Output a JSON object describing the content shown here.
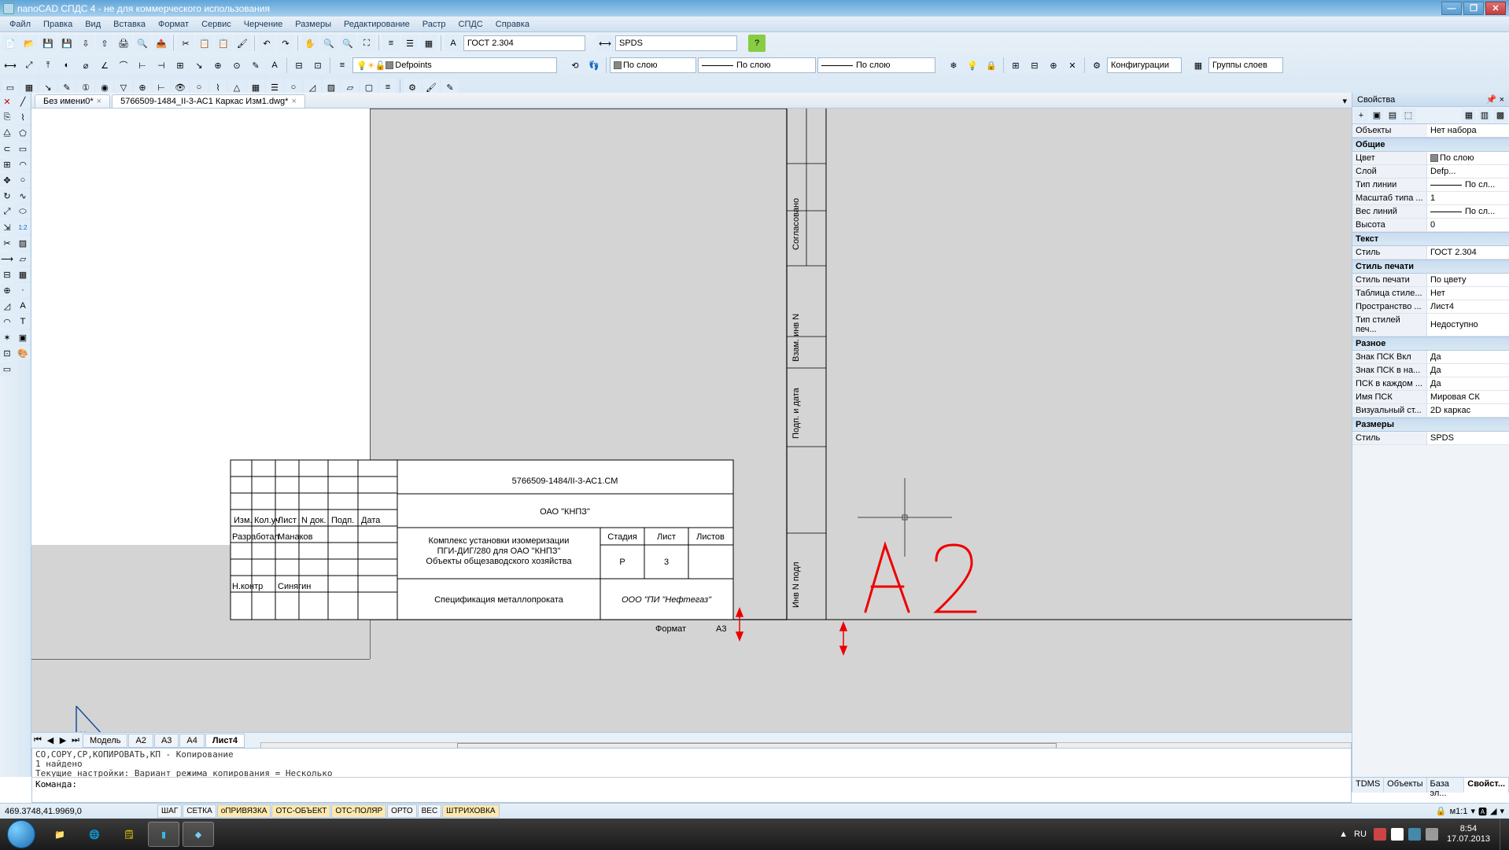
{
  "title": "nanoCAD СПДС 4 - не для коммерческого использования",
  "menubar": [
    "Файл",
    "Правка",
    "Вид",
    "Вставка",
    "Формат",
    "Сервис",
    "Черчение",
    "Размеры",
    "Редактирование",
    "Растр",
    "СПДС",
    "Справка"
  ],
  "toolbar1": {
    "textstyle": "ГОСТ 2.304",
    "dimstyle": "SPDS"
  },
  "toolbar2": {
    "layer_name": "Defpoints",
    "lineweight": "По слою",
    "linetype_label": "По слою",
    "color_label": "По слою",
    "config_btn": "Конфигурации",
    "groups_btn": "Группы слоев"
  },
  "doc_tabs": [
    {
      "label": "Без имени0*",
      "active": false
    },
    {
      "label": "5766509-1484_II-3-АС1 Каркас Изм1.dwg*",
      "active": true
    }
  ],
  "bottom_tabs": {
    "items": [
      "Модель",
      "А2",
      "А3",
      "А4",
      "Лист4"
    ],
    "active": 4
  },
  "drawing": {
    "title_block_number": "5766509-1484/II-3-АС1.СМ",
    "org": "ОАО \"КНПЗ\"",
    "desc1": "Комплекс установки изомеризации",
    "desc2": "ПГИ-ДИГ/280 для ОАО \"КНПЗ\"",
    "desc3": "Объекты общезаводского хозяйства",
    "spec": "Спецификация металлопроката",
    "contractor": "ООО \"ПИ \"Нефтегаз\"",
    "col_izm": "Изм.",
    "col_kol": "Кол.уч",
    "col_list": "Лист",
    "col_ndoc": "N док.",
    "col_podp": "Подп.",
    "col_data": "Дата",
    "row_razrab": "Разработал",
    "row_razrab_name": "Манаков",
    "row_nkontr": "Н.контр",
    "row_nkontr_name": "Синягин",
    "hdr_stadia": "Стадия",
    "hdr_list": "Лист",
    "hdr_listov": "Листов",
    "val_stadia": "Р",
    "val_list": "3",
    "format_label": "Формат",
    "format_value": "А3",
    "side_soglas": "Согласовано",
    "side_vzam": "Взам. инв N",
    "side_podp": "Подп. и дата",
    "side_inv": "Инв N подл",
    "annotation": "А 2"
  },
  "command": {
    "hist": "CO,COPY,CP,КОПИРОВАТЬ,КП - Копирование\n1 найдено\nТекущие настройки:  Вариант режима копирования = Несколько",
    "prompt": "Команда:"
  },
  "status": {
    "coord": "469.3748,41.9969,0",
    "toggles": [
      {
        "label": "ШАГ",
        "on": false
      },
      {
        "label": "СЕТКА",
        "on": false
      },
      {
        "label": "оПРИВЯЗКА",
        "on": true
      },
      {
        "label": "ОТС-ОБЪЕКТ",
        "on": true
      },
      {
        "label": "ОТС-ПОЛЯР",
        "on": true
      },
      {
        "label": "ОРТО",
        "on": false
      },
      {
        "label": "ВЕС",
        "on": false
      },
      {
        "label": "ШТРИХОВКА",
        "on": true
      }
    ],
    "scale": "м1:1"
  },
  "props": {
    "title": "Свойства",
    "obj_label": "Объекты",
    "obj_value": "Нет набора",
    "sections": [
      {
        "name": "Общие",
        "rows": [
          {
            "k": "Цвет",
            "v": "По слою",
            "swatch": "#888"
          },
          {
            "k": "Слой",
            "v": "Defp..."
          },
          {
            "k": "Тип линии",
            "v": "По сл...",
            "line": true
          },
          {
            "k": "Масштаб типа ...",
            "v": "1"
          },
          {
            "k": "Вес линий",
            "v": "По сл...",
            "line": true
          },
          {
            "k": "Высота",
            "v": "0"
          }
        ]
      },
      {
        "name": "Текст",
        "rows": [
          {
            "k": "Стиль",
            "v": "ГОСТ 2.304"
          }
        ]
      },
      {
        "name": "Стиль печати",
        "rows": [
          {
            "k": "Стиль печати",
            "v": "По цвету"
          },
          {
            "k": "Таблица стиле...",
            "v": "Нет"
          },
          {
            "k": "Пространство ...",
            "v": "Лист4"
          },
          {
            "k": "Тип стилей печ...",
            "v": "Недоступно"
          }
        ]
      },
      {
        "name": "Разное",
        "rows": [
          {
            "k": "Знак ПСК Вкл",
            "v": "Да"
          },
          {
            "k": "Знак ПСК в на...",
            "v": "Да"
          },
          {
            "k": "ПСК в каждом ...",
            "v": "Да"
          },
          {
            "k": "Имя ПСК",
            "v": "Мировая СК"
          },
          {
            "k": "Визуальный ст...",
            "v": "2D каркас"
          }
        ]
      },
      {
        "name": "Размеры",
        "rows": [
          {
            "k": "Стиль",
            "v": "SPDS"
          }
        ]
      }
    ],
    "bottom_tabs": [
      "TDMS",
      "Объекты",
      "База эл...",
      "Свойст..."
    ]
  },
  "tray": {
    "lang": "RU",
    "time": "8:54",
    "date": "17.07.2013"
  }
}
